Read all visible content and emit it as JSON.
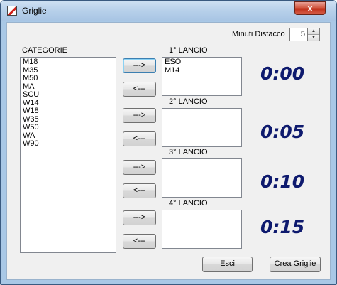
{
  "window": {
    "title": "Griglie",
    "close_glyph": "x"
  },
  "minuti": {
    "label": "Minuti Distacco",
    "value": "5",
    "up_glyph": "▲",
    "down_glyph": "▼"
  },
  "categorie": {
    "label": "CATEGORIE",
    "items": [
      "M18",
      "M35",
      "M50",
      "MA",
      "SCU",
      "W14",
      "W18",
      "W35",
      "W50",
      "WA",
      "W90"
    ]
  },
  "buttons": {
    "add": "--->",
    "remove": "<---",
    "esci": "Esci",
    "crea": "Crea Griglie"
  },
  "lanci": [
    {
      "label": "1° LANCIO",
      "items": [
        "ESO",
        "M14"
      ],
      "time": "0:00"
    },
    {
      "label": "2° LANCIO",
      "items": [],
      "time": "0:05"
    },
    {
      "label": "3° LANCIO",
      "items": [],
      "time": "0:10"
    },
    {
      "label": "4° LANCIO",
      "items": [],
      "time": "0:15"
    }
  ],
  "colors": {
    "timer": "#0e1a6e",
    "title_bar": "#b7d0ea",
    "close_button": "#c0301a"
  }
}
